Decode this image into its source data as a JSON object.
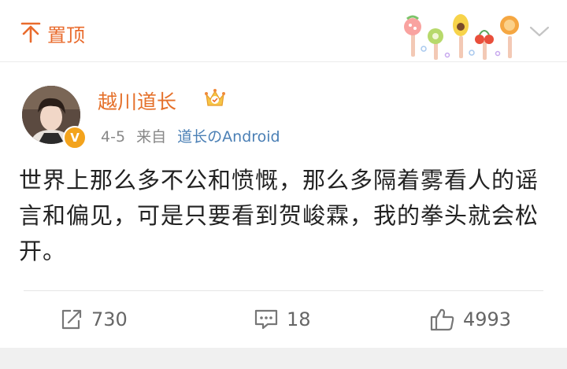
{
  "topbar": {
    "pin_label": "置顶",
    "pin_icon": "pin-top-icon",
    "decoration": "fruit-lollipops-decoration",
    "chevron_icon": "chevron-down-icon"
  },
  "post": {
    "author": "越川道长",
    "author_badge": "crown-badge-icon",
    "verified_badge": "V",
    "date": "4-5",
    "source_prefix": "来自",
    "source": "道长のAndroid",
    "text": "世界上那么多不公和愤慨，那么多隔着雾看人的谣言和偏见，可是只要看到贺峻霖，我的拳头就会松开。"
  },
  "actions": {
    "repost_count": "730",
    "comment_count": "18",
    "like_count": "4993"
  },
  "colors": {
    "accent_orange": "#e96b2d",
    "link_blue": "#4a7fb5",
    "text": "#222222",
    "meta_gray": "#888888"
  }
}
